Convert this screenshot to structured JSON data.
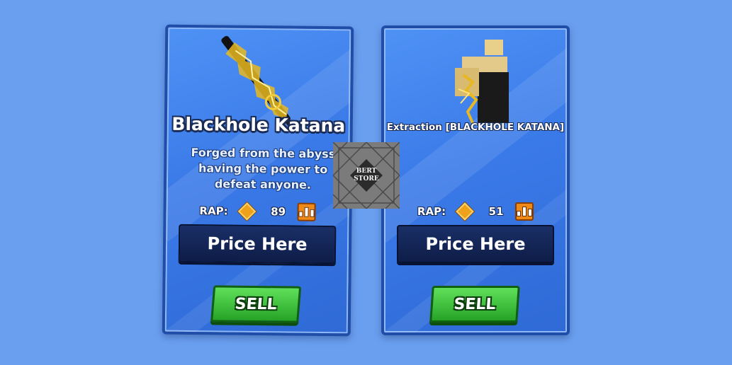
{
  "cards": [
    {
      "item_name": "Blackhole Katana",
      "description": "Forged from the abyss having the power to defeat anyone.",
      "rap_label": "RAP:",
      "rap_value": "89",
      "price_label": "Price Here",
      "sell_label": "SELL",
      "icon": "katana-icon"
    },
    {
      "item_name": "Extraction [BLACKHOLE KATANA]",
      "description": "",
      "rap_label": "RAP:",
      "rap_value": "51",
      "price_label": "Price Here",
      "sell_label": "SELL",
      "icon": "character-icon"
    }
  ],
  "watermark": {
    "line1": "BERT",
    "line2": "STORE"
  },
  "colors": {
    "background": "#6a9ff0",
    "card": "#3a7ae8",
    "sell": "#26a326",
    "price_box": "#0e1d48",
    "rap_gem": "#f0a11b"
  }
}
